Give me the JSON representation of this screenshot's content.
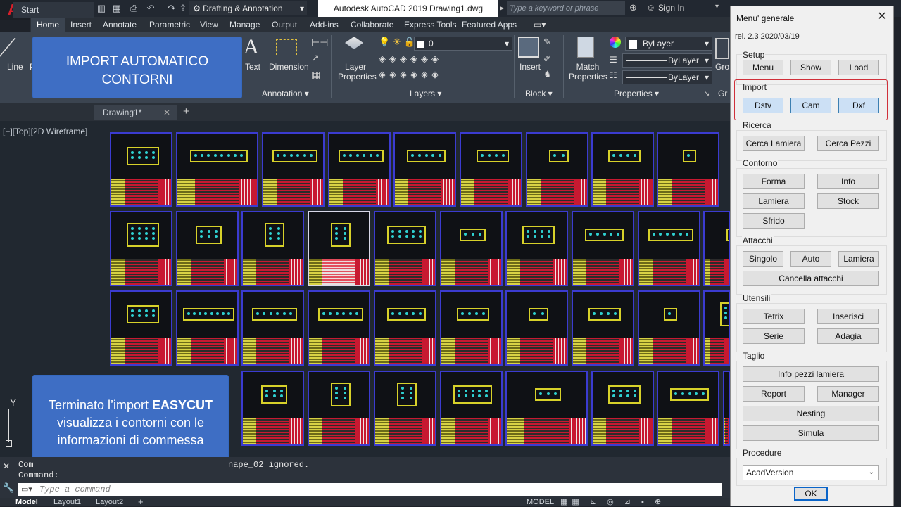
{
  "titlebar": {
    "workspace": "Drafting & Annotation",
    "title": "Autodesk AutoCAD 2019   Drawing1.dwg",
    "search_placeholder": "Type a keyword or phrase",
    "sign_in": "Sign In"
  },
  "ribbon": {
    "tabs": [
      "Home",
      "Insert",
      "Annotate",
      "Parametric",
      "View",
      "Manage",
      "Output",
      "Add-ins",
      "Collaborate",
      "Express Tools",
      "Featured Apps"
    ],
    "tools": {
      "line": "Line",
      "text": "Text",
      "dimension": "Dimension",
      "layer_properties": "Layer\nProperties",
      "insert": "Insert",
      "match_properties": "Match\nProperties",
      "layer_value": "0",
      "bylayer_color": "ByLayer",
      "bylayer_linetype": "ByLayer",
      "bylayer_lineweight": "ByLayer",
      "group": "Gro"
    },
    "panels": {
      "annotation": "Annotation ▾",
      "layers": "Layers ▾",
      "block": "Block ▾",
      "properties": "Properties ▾",
      "groups": "Gr"
    }
  },
  "filetabs": [
    "Start",
    "Drawing1*"
  ],
  "canvas": {
    "view_label": "[−][Top][2D Wireframe]",
    "axis_y": "Y"
  },
  "callouts": {
    "top": "IMPORT AUTOMATICO CONTORNI",
    "bottom_line1": "Terminato l’import ",
    "bottom_brand": "EASYCUT",
    "bottom_line2": "visualizza i contorni con le informazioni di commessa"
  },
  "command": {
    "line1_prefix": "Com",
    "line1_suffix": "nape_02  ignored.",
    "line2": "Command:",
    "placeholder": "Type a command"
  },
  "status": {
    "tabs": [
      "Model",
      "Layout1",
      "Layout2"
    ],
    "model": "MODEL"
  },
  "dialog": {
    "title": "Menu' generale",
    "version": "rel. 2.3 2020/03/19",
    "groups": {
      "setup": {
        "label": "Setup",
        "buttons": [
          "Menu",
          "Show",
          "Load"
        ]
      },
      "import": {
        "label": "Import",
        "buttons": [
          "Dstv",
          "Cam",
          "Dxf"
        ]
      },
      "ricerca": {
        "label": "Ricerca",
        "buttons": [
          "Cerca Lamiera",
          "Cerca Pezzi"
        ]
      },
      "contorno": {
        "label": "Contorno",
        "buttons": [
          "Forma",
          "Info",
          "Lamiera",
          "Stock",
          "Sfrido"
        ]
      },
      "attacchi": {
        "label": "Attacchi",
        "buttons": [
          "Singolo",
          "Auto",
          "Lamiera",
          "Cancella attacchi"
        ]
      },
      "utensili": {
        "label": "Utensili",
        "buttons": [
          "Tetrix",
          "Inserisci",
          "Serie",
          "Adagia"
        ]
      },
      "taglio": {
        "label": "Taglio",
        "buttons": [
          "Info pezzi lamiera",
          "Report",
          "Manager",
          "Nesting",
          "Simula"
        ]
      },
      "procedure": {
        "label": "Procedure",
        "selected": "AcadVersion"
      }
    },
    "ok": "OK"
  }
}
